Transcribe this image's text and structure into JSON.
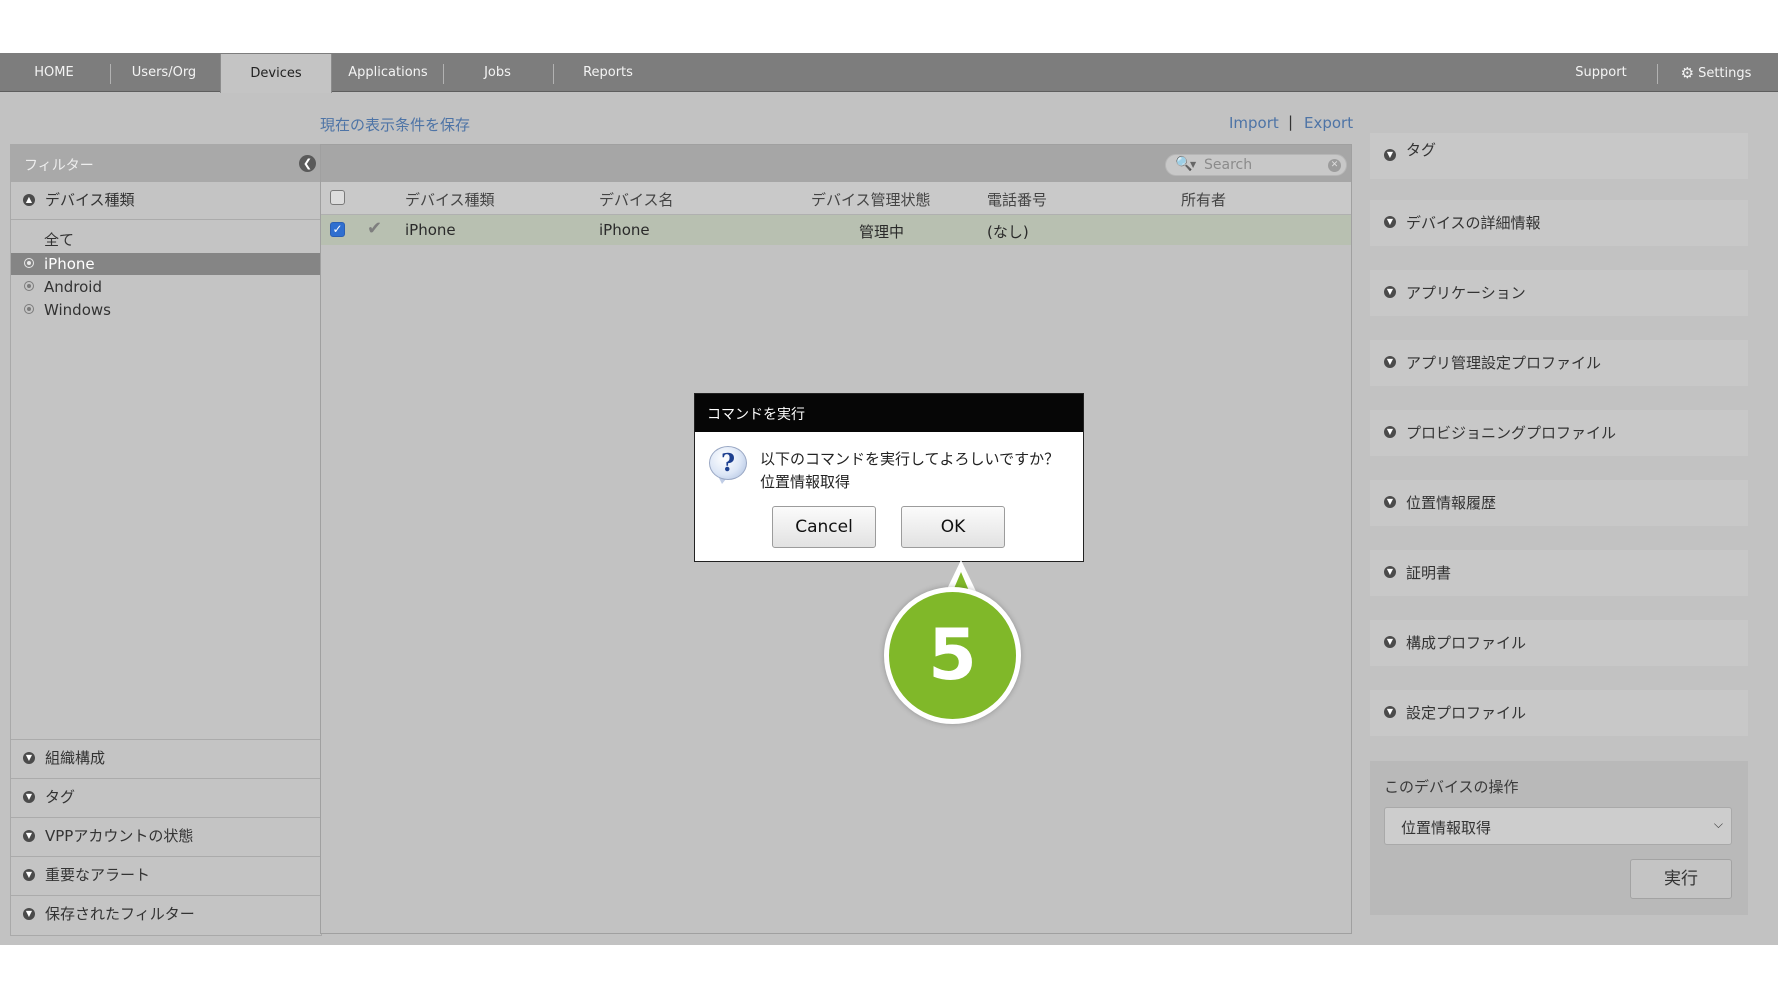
{
  "nav": {
    "items": [
      "HOME",
      "Users/Org",
      "Devices",
      "Applications",
      "Jobs",
      "Reports"
    ],
    "active": "Devices",
    "support": "Support",
    "settings": "Settings"
  },
  "toplinks": {
    "save_filter": "現在の表示条件を保存",
    "import": "Import",
    "separator": "|",
    "export": "Export"
  },
  "filter": {
    "title": "フィルター",
    "device_type": {
      "header": "デバイス種類",
      "items": [
        "全て",
        "iPhone",
        "Android",
        "Windows"
      ],
      "selected": "iPhone"
    },
    "sections": [
      "組織構成",
      "タグ",
      "VPPアカウントの状態",
      "重要なアラート",
      "保存されたフィルター"
    ]
  },
  "grid": {
    "search_placeholder": "Search",
    "columns": [
      "デバイス種類",
      "デバイス名",
      "デバイス管理状態",
      "電話番号",
      "所有者"
    ],
    "rows": [
      {
        "checked": true,
        "device_type": "iPhone",
        "device_name": "iPhone",
        "status": "管理中",
        "phone": "(なし)",
        "owner": ""
      }
    ]
  },
  "right_panel": {
    "sections": [
      "タグ",
      "デバイスの詳細情報",
      "アプリケーション",
      "アプリ管理設定プロファイル",
      "プロビジョニングプロファイル",
      "位置情報履歴",
      "証明書",
      "構成プロファイル",
      "設定プロファイル"
    ],
    "operations": {
      "title": "このデバイスの操作",
      "selected_command": "位置情報取得",
      "run_label": "実行"
    }
  },
  "dialog": {
    "title": "コマンドを実行",
    "message_line1": "以下のコマンドを実行してよろしいですか？",
    "message_line2": "位置情報取得",
    "cancel": "Cancel",
    "ok": "OK"
  },
  "callout": {
    "step": "5",
    "color": "#80b829"
  }
}
